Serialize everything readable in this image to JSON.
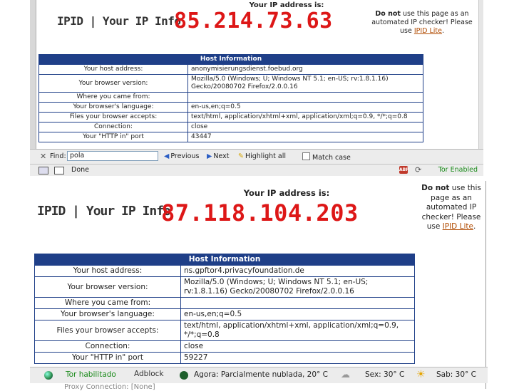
{
  "top": {
    "ip_label": "Your IP address is:",
    "logo": "IPID | Your IP Info",
    "ip": "85.214.73.63",
    "note_bold": "Do not",
    "note_text": "use this page as an automated IP checker! Please use",
    "note_link": "IPID Lite",
    "note_end": ".",
    "table": {
      "header": "Host Information",
      "rows": [
        {
          "key": "Your host address:",
          "value": "anonymisierungsdienst.foebud.org"
        },
        {
          "key": "Your browser version:",
          "value": "Mozilla/5.0 (Windows; U; Windows NT 5.1; en-US; rv:1.8.1.16) Gecko/20080702 Firefox/2.0.0.16"
        },
        {
          "key": "Where you came from:",
          "value": ""
        },
        {
          "key": "Your browser's language:",
          "value": "en-us,en;q=0.5"
        },
        {
          "key": "Files your browser accepts:",
          "value": "text/html, application/xhtml+xml, application/xml;q=0.9, */*;q=0.8"
        },
        {
          "key": "Connection:",
          "value": "close"
        },
        {
          "key": "Your \"HTTP in\" port",
          "value": "43447"
        }
      ]
    },
    "findbar": {
      "close": "✕",
      "find_label": "Find:",
      "find_value": "pola",
      "previous": "Previous",
      "next": "Next",
      "highlight": "Highlight all",
      "match_case": "Match case"
    },
    "status": {
      "done": "Done",
      "adblock_badge": "ABP",
      "tor": "Tor Enabled"
    }
  },
  "bottom": {
    "ip_label": "Your IP address is:",
    "logo": "IPID | Your IP Info",
    "ip": "87.118.104.203",
    "note_bold": "Do not",
    "note_text": "use this page as an automated IP checker! Please use",
    "note_link": "IPID Lite",
    "note_end": ".",
    "table": {
      "header": "Host Information",
      "rows": [
        {
          "key": "Your host address:",
          "value": "ns.gpftor4.privacyfoundation.de"
        },
        {
          "key": "Your browser version:",
          "value": "Mozilla/5.0 (Windows; U; Windows NT 5.1; en-US; rv:1.8.1.16) Gecko/20080702 Firefox/2.0.0.16"
        },
        {
          "key": "Where you came from:",
          "value": ""
        },
        {
          "key": "Your browser's language:",
          "value": "en-us,en;q=0.5"
        },
        {
          "key": "Files your browser accepts:",
          "value": "text/html, application/xhtml+xml, application/xml;q=0.9, */*;q=0.8"
        },
        {
          "key": "Connection:",
          "value": "close"
        },
        {
          "key": "Your \"HTTP in\" port",
          "value": "59227"
        }
      ]
    },
    "status": {
      "tor": "Tor habilitado",
      "adblock": "Adblock",
      "weather_now": "Agora: Parcialmente nublada, 20° C",
      "weather_fri": "Sex: 30° C",
      "weather_sat": "Sab: 30° C"
    },
    "cut_off_row": "Proxy Connection:   [None]"
  }
}
